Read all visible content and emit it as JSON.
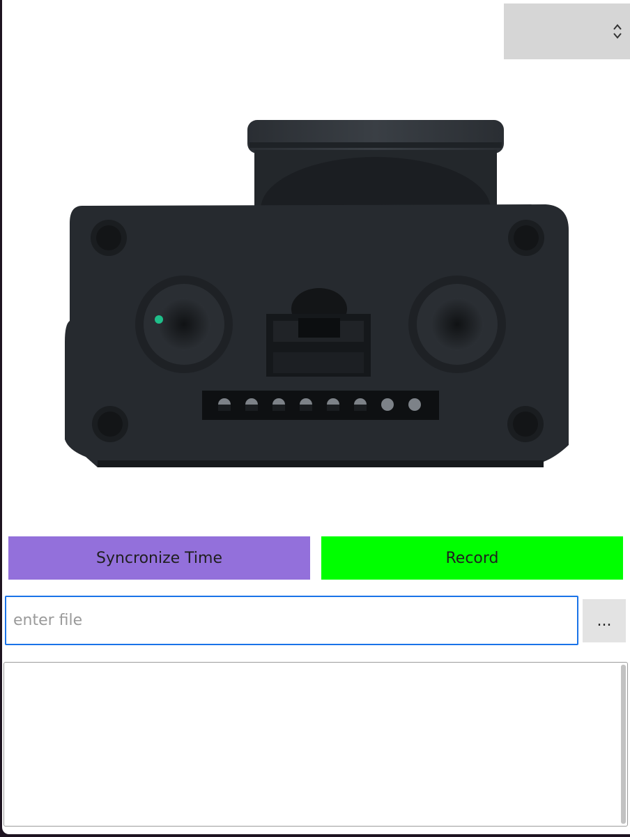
{
  "device_select": {
    "selected": "",
    "icon": "up-down-chevron-icon"
  },
  "device_image": {
    "icon": "camera-module-render"
  },
  "buttons": {
    "sync_label": "Syncronize Time",
    "record_label": "Record",
    "browse_label": "..."
  },
  "file_input": {
    "value": "",
    "placeholder": "enter file"
  },
  "log": {
    "text": ""
  },
  "colors": {
    "sync": "#9370db",
    "record": "#00ff00",
    "focus": "#1a73e8"
  }
}
